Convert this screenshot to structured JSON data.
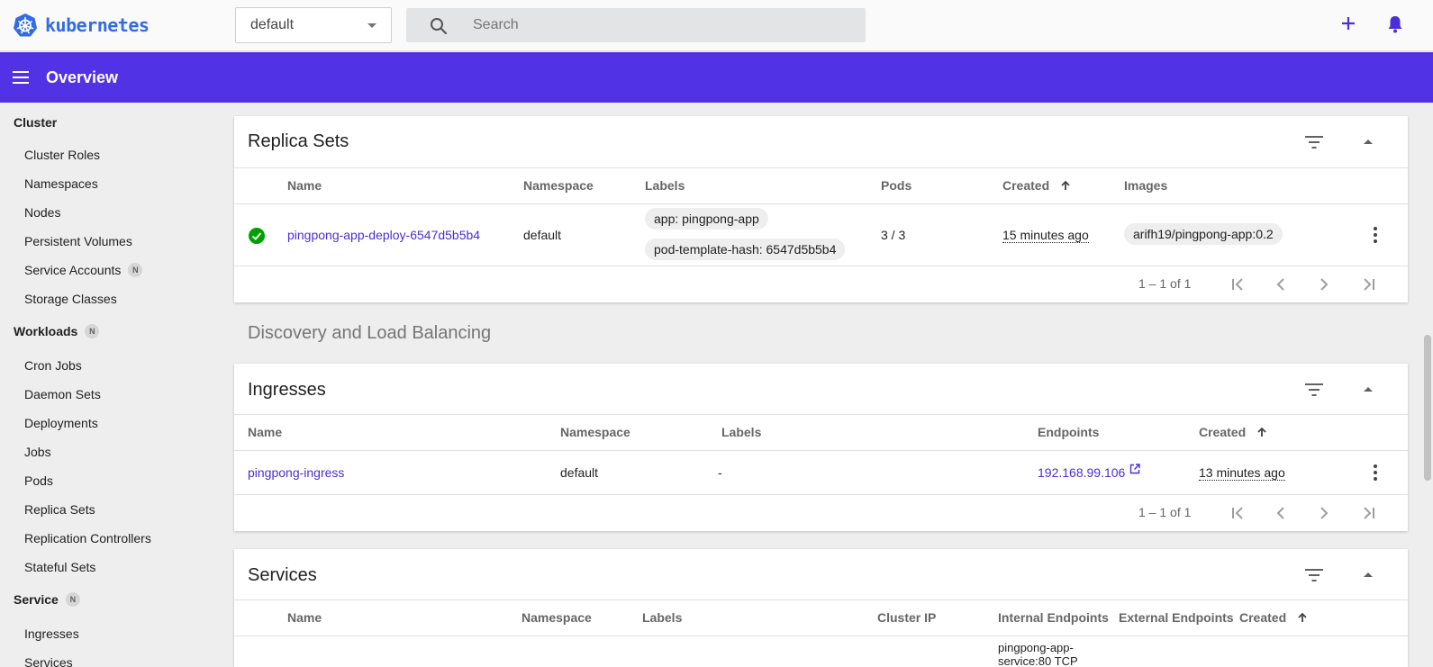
{
  "header": {
    "logo_text": "kubernetes",
    "namespace_value": "default",
    "search_placeholder": "Search"
  },
  "appbar": {
    "title": "Overview"
  },
  "colors": {
    "brand": "#326ce5",
    "appbar": "#5132e5",
    "link": "#4b2ed8",
    "success": "#00a000"
  },
  "sidebar": {
    "cluster": {
      "label": "Cluster",
      "items": [
        "Cluster Roles",
        "Namespaces",
        "Nodes",
        "Persistent Volumes",
        "Service Accounts",
        "Storage Classes"
      ],
      "service_accounts_badge": "N"
    },
    "workloads": {
      "label": "Workloads",
      "badge": "N",
      "items": [
        "Cron Jobs",
        "Daemon Sets",
        "Deployments",
        "Jobs",
        "Pods",
        "Replica Sets",
        "Replication Controllers",
        "Stateful Sets"
      ]
    },
    "service": {
      "label": "Service",
      "badge": "N",
      "items": [
        "Ingresses",
        "Services"
      ]
    }
  },
  "replica_sets": {
    "title": "Replica Sets",
    "columns": {
      "name": "Name",
      "namespace": "Namespace",
      "labels": "Labels",
      "pods": "Pods",
      "created": "Created",
      "images": "Images"
    },
    "rows": [
      {
        "name": "pingpong-app-deploy-6547d5b5b4",
        "namespace": "default",
        "labels": [
          "app: pingpong-app",
          "pod-template-hash: 6547d5b5b4"
        ],
        "pods": "3 / 3",
        "created": "15 minutes ago",
        "image": "arifh19/pingpong-app:0.2"
      }
    ],
    "pagination": "1 – 1 of 1"
  },
  "discovery_heading": "Discovery and Load Balancing",
  "ingresses": {
    "title": "Ingresses",
    "columns": {
      "name": "Name",
      "namespace": "Namespace",
      "labels": "Labels",
      "endpoints": "Endpoints",
      "created": "Created"
    },
    "rows": [
      {
        "name": "pingpong-ingress",
        "namespace": "default",
        "labels": "-",
        "endpoint": "192.168.99.106",
        "created": "13 minutes ago"
      }
    ],
    "pagination": "1 – 1 of 1"
  },
  "services": {
    "title": "Services",
    "columns": {
      "name": "Name",
      "namespace": "Namespace",
      "labels": "Labels",
      "cluster_ip": "Cluster IP",
      "internal_endpoints": "Internal Endpoints",
      "external_endpoints": "External Endpoints",
      "created": "Created"
    },
    "partial_row": {
      "internal_endpoint_line1": "pingpong-app-",
      "internal_endpoint_line2": "service:80 TCP"
    }
  }
}
